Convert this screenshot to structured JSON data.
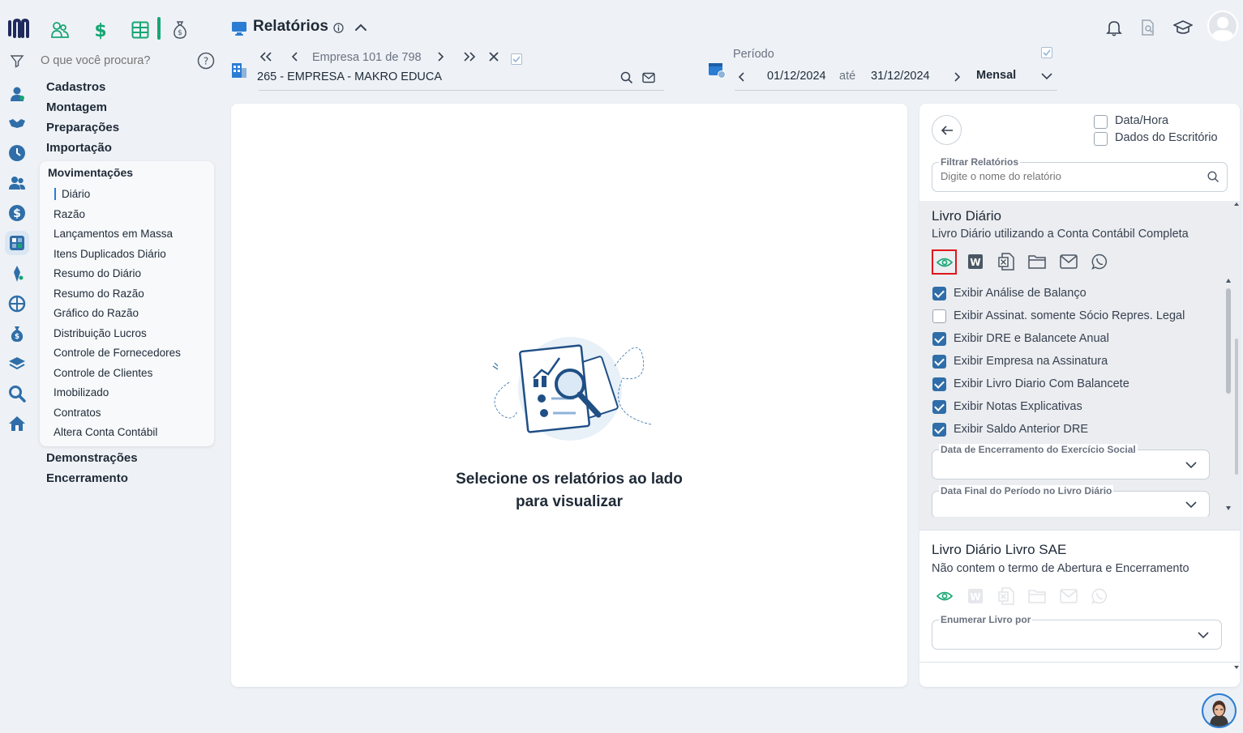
{
  "search": {
    "placeholder": "O que você procura?"
  },
  "nav": {
    "top_items": [
      "Cadastros",
      "Montagem",
      "Preparações",
      "Importação"
    ],
    "submenu_title": "Movimentações",
    "submenu_items": [
      "Diário",
      "Razão",
      "Lançamentos em Massa",
      "Itens Duplicados Diário",
      "Resumo do Diário",
      "Resumo do Razão",
      "Gráfico do Razão",
      "Distribuição Lucros",
      "Controle de Fornecedores",
      "Controle de Clientes",
      "Imobilizado",
      "Contratos",
      "Altera Conta Contábil"
    ],
    "bottom_items": [
      "Demonstrações",
      "Encerramento"
    ]
  },
  "header": {
    "title": "Relatórios",
    "company_counter": "Empresa 101 de 798",
    "company_name": "265 - EMPRESA - MAKRO EDUCA",
    "period_label": "Período",
    "date_from": "01/12/2024",
    "date_sep": "até",
    "date_to": "31/12/2024",
    "period_type": "Mensal"
  },
  "preview": {
    "message_line1": "Selecione os relatórios ao lado",
    "message_line2": "para visualizar"
  },
  "reports_panel": {
    "data_hora_label": "Data/Hora",
    "dados_escritorio_label": "Dados do Escritório",
    "filter_label": "Filtrar Relatórios",
    "filter_placeholder": "Digite o nome do relatório",
    "report1": {
      "title": "Livro Diário",
      "subtitle": "Livro Diário utilizando a Conta Contábil Completa",
      "options": [
        {
          "label": "Exibir Análise de Balanço",
          "checked": true
        },
        {
          "label": "Exibir Assinat. somente Sócio Repres. Legal",
          "checked": false
        },
        {
          "label": "Exibir DRE e Balancete Anual",
          "checked": true
        },
        {
          "label": "Exibir Empresa na Assinatura",
          "checked": true
        },
        {
          "label": "Exibir Livro Diario Com Balancete",
          "checked": true
        },
        {
          "label": "Exibir Notas Explicativas",
          "checked": true
        },
        {
          "label": "Exibir Saldo Anterior DRE",
          "checked": true
        }
      ],
      "field1_label": "Data de Encerramento do Exercício Social",
      "field2_label": "Data Final do Período no Livro Diário"
    },
    "report2": {
      "title": "Livro Diário Livro SAE",
      "subtitle": "Não contem o termo de Abertura e Encerramento",
      "field_label": "Enumerar Livro por"
    }
  },
  "colors": {
    "accent": "#2f6ea8",
    "green": "#17a673",
    "highlight_border": "#e0161b"
  },
  "icons": {
    "rail": [
      "user-icon",
      "handshake-icon",
      "clock-icon",
      "people-icon",
      "dollar-circle-icon",
      "calculator-icon",
      "pin-icon",
      "globe-icon",
      "money-bag-icon",
      "layers-icon",
      "search-icon",
      "home-icon"
    ],
    "modules": [
      "users-module-icon",
      "dollar-module-icon",
      "spreadsheet-module-icon",
      "money-bag-module-icon"
    ]
  }
}
